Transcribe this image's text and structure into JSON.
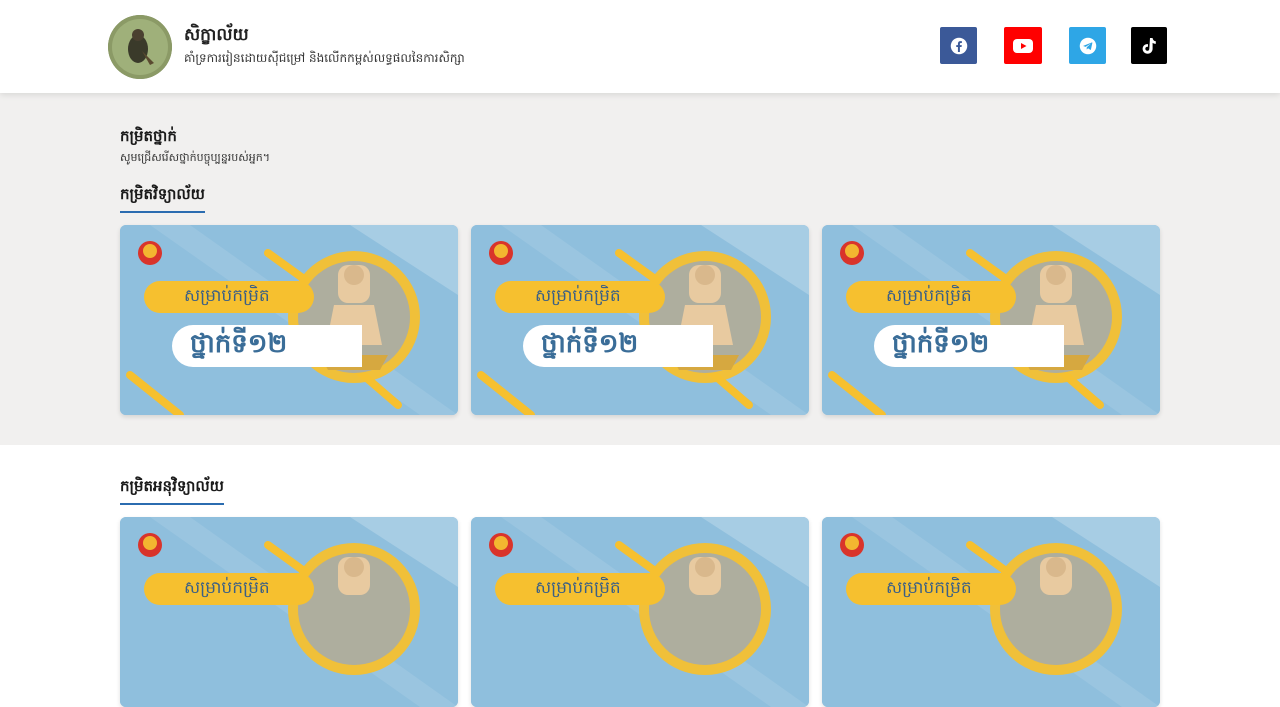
{
  "header": {
    "site_title": "សិក្ខាល័យ",
    "site_subtitle": "គាំទ្រការរៀនដោយស៊ីជម្រៅ និងលើកកម្ពស់លទ្ធផលនៃការសិក្សា",
    "social": [
      "facebook-icon",
      "youtube-icon",
      "telegram-icon",
      "tiktok-icon"
    ]
  },
  "main": {
    "title": "កម្រិតថ្នាក់",
    "subtitle": "សូមជ្រើសរើសថ្នាក់បច្ចុប្បន្នរបស់អ្នក។",
    "categories": [
      {
        "label": "កម្រិតវិទ្យាល័យ",
        "cards": [
          {
            "top": "សម្រាប់កម្រិត",
            "grade": "ថ្នាក់ទី១២"
          },
          {
            "top": "សម្រាប់កម្រិត",
            "grade": "ថ្នាក់ទី១២"
          },
          {
            "top": "សម្រាប់កម្រិត",
            "grade": "ថ្នាក់ទី១២"
          }
        ]
      },
      {
        "label": "កម្រិតអនុវិទ្យាល័យ",
        "cards": [
          {
            "top": "សម្រាប់កម្រិត"
          },
          {
            "top": "សម្រាប់កម្រិត"
          },
          {
            "top": "សម្រាប់កម្រិត"
          }
        ]
      }
    ]
  },
  "colors": {
    "card_bg": "#8fbfdd",
    "accent_yellow": "#f6c02f",
    "facebook": "#3b5998",
    "youtube": "#ff0000",
    "telegram": "#2ea6e6",
    "tiktok": "#000000"
  }
}
